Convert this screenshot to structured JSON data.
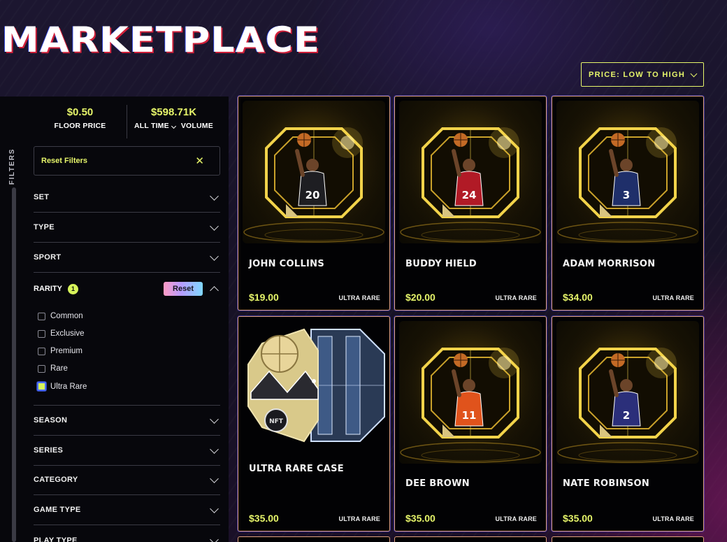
{
  "header": {
    "title": "MARKETPLACE",
    "sort_label": "PRICE: LOW TO HIGH"
  },
  "sidebar": {
    "filters_label": "FILTERS",
    "floor_price": {
      "value": "$0.50",
      "label": "FLOOR PRICE"
    },
    "volume": {
      "value": "$598.71K",
      "period": "ALL TIME",
      "label": "VOLUME"
    },
    "reset_filters_label": "Reset Filters",
    "filter_groups": {
      "set": "SET",
      "type": "TYPE",
      "sport": "SPORT",
      "season": "SEASON",
      "series": "SERIES",
      "category": "CATEGORY",
      "game_type": "GAME TYPE",
      "play_type": "PLAY TYPE"
    },
    "rarity": {
      "label": "RARITY",
      "count": "1",
      "reset_label": "Reset",
      "options": [
        {
          "label": "Common",
          "checked": false
        },
        {
          "label": "Exclusive",
          "checked": false
        },
        {
          "label": "Premium",
          "checked": false
        },
        {
          "label": "Rare",
          "checked": false
        },
        {
          "label": "Ultra Rare",
          "checked": true
        }
      ]
    }
  },
  "cards": [
    {
      "name": "JOHN COLLINS",
      "price": "$19.00",
      "rarity": "ULTRA RARE",
      "jersey": "20",
      "jersey_color": "#1e1e22",
      "art": "player"
    },
    {
      "name": "BUDDY HIELD",
      "price": "$20.00",
      "rarity": "ULTRA RARE",
      "jersey": "24",
      "jersey_color": "#b11a26",
      "art": "player"
    },
    {
      "name": "ADAM MORRISON",
      "price": "$34.00",
      "rarity": "ULTRA RARE",
      "jersey": "3",
      "jersey_color": "#1f2f6a",
      "art": "player"
    },
    {
      "name": "ULTRA RARE CASE",
      "price": "$35.00",
      "rarity": "ULTRA RARE",
      "art": "case"
    },
    {
      "name": "DEE BROWN",
      "price": "$35.00",
      "rarity": "ULTRA RARE",
      "jersey": "11",
      "jersey_color": "#e0531c",
      "art": "player"
    },
    {
      "name": "NATE ROBINSON",
      "price": "$35.00",
      "rarity": "ULTRA RARE",
      "jersey": "2",
      "jersey_color": "#2b2f7a",
      "art": "player"
    }
  ],
  "colors": {
    "accent": "#e6f56a",
    "card_border": "#e0a07a",
    "badge": "#d7f45a"
  }
}
